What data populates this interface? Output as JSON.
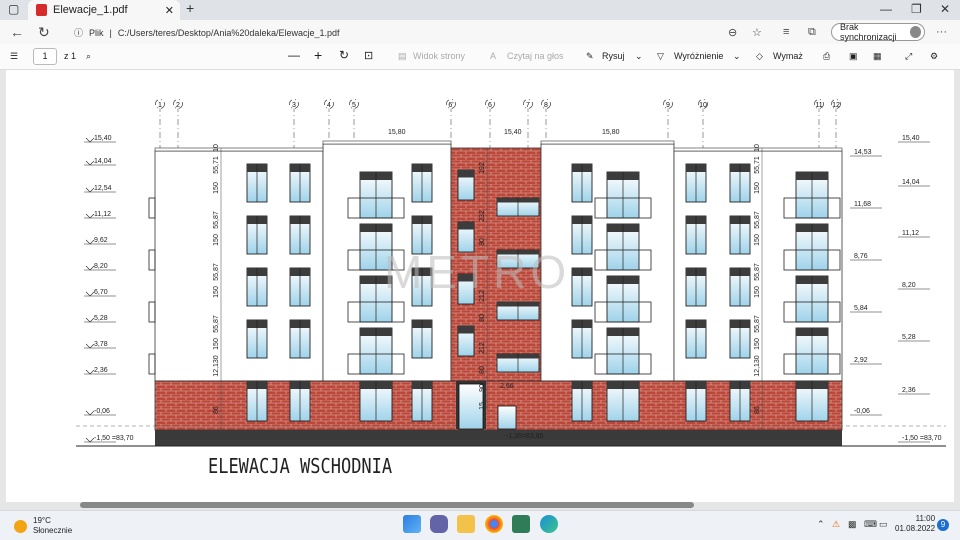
{
  "browser": {
    "tab_title": "Elewacje_1.pdf",
    "tab_close": "✕",
    "new_tab": "+",
    "url_prefix": "Plik",
    "url": "C:/Users/teres/Desktop/Ania%20daleka/Elewacje_1.pdf",
    "sync_label": "Brak synchronizacji",
    "win_min": "—",
    "win_max": "❐",
    "win_close": "✕"
  },
  "pdf_toolbar": {
    "page_number": "1",
    "page_total": "z 1",
    "zoom_out": "—",
    "zoom_in": "+",
    "page_view": "Widok strony",
    "read_aloud": "Czytaj na głos",
    "draw": "Rysuj",
    "highlight": "Wyróżnienie",
    "erase": "Wymaż"
  },
  "drawing": {
    "title": "ELEWACJA WSCHODNIA",
    "watermark": "METRO",
    "grid_labels": [
      "1",
      "2",
      "3",
      "4",
      "5",
      "6'",
      "6",
      "7",
      "8",
      "9",
      "10",
      "11",
      "12"
    ],
    "left_levels": [
      "15,40",
      "14,04",
      "12,54",
      "11,12",
      "9,62",
      "8,20",
      "6,70",
      "5,28",
      "3,78",
      "2,36",
      "-0,06",
      "-1,50 =83,70"
    ],
    "right_levels": [
      "15,40",
      "14,53",
      "14,04",
      "11,68",
      "11,12",
      "8,76",
      "8,20",
      "5,84",
      "5,28",
      "2,92",
      "2,36",
      "-0,06",
      "-1,50 =83,70"
    ],
    "top_levels": [
      "15,80",
      "15,40",
      "15,80"
    ],
    "entrance_levels": [
      "2,66",
      "-1,35=83,85"
    ],
    "dims_left": [
      "10",
      "55,71",
      "150",
      "55,87",
      "150",
      "55,87",
      "150",
      "55,87",
      "150",
      "12,130",
      "86"
    ],
    "dims_mid": [
      "192",
      "232",
      "80",
      "212",
      "80",
      "212",
      "80",
      "90",
      "15"
    ]
  },
  "taskbar": {
    "temp": "19°C",
    "weather": "Słonecznie",
    "time": "11:00",
    "date": "01.08.2022",
    "notifications": "9"
  }
}
